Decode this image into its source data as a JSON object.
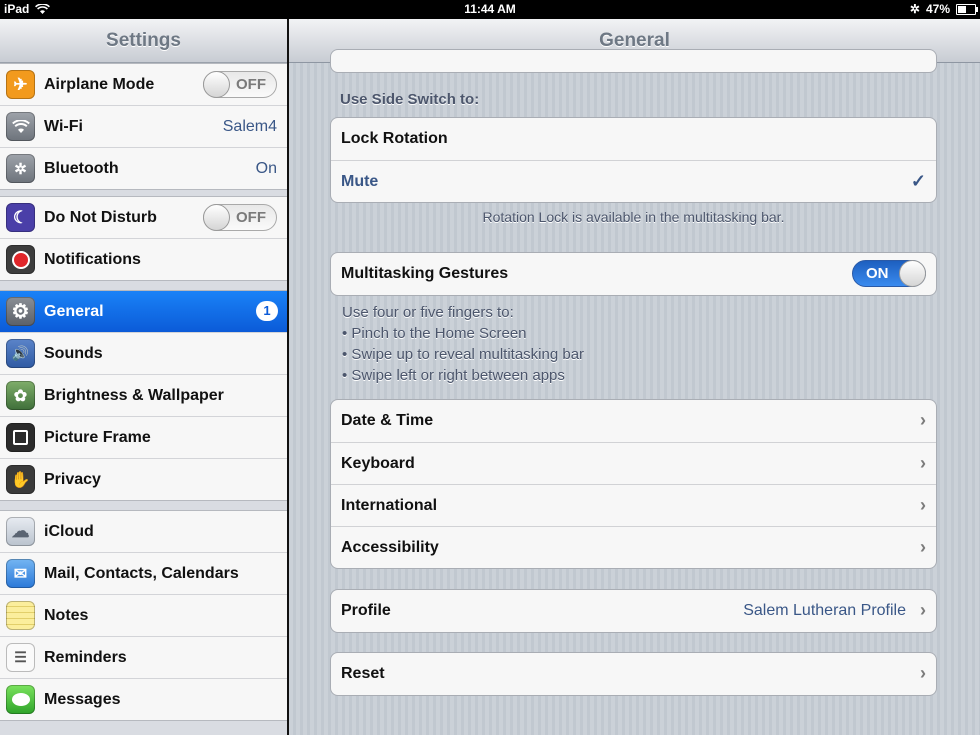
{
  "status_bar": {
    "device": "iPad",
    "time": "11:44 AM",
    "battery": "47%",
    "battery_level": 0.47
  },
  "sidebar": {
    "title": "Settings",
    "groups": [
      {
        "items": [
          {
            "label": "Airplane Mode",
            "icon": "airplane-icon",
            "toggle": "OFF"
          },
          {
            "label": "Wi-Fi",
            "icon": "wifi-icon",
            "value": "Salem4"
          },
          {
            "label": "Bluetooth",
            "icon": "bluetooth-icon",
            "value": "On"
          }
        ]
      },
      {
        "items": [
          {
            "label": "Do Not Disturb",
            "icon": "moon-icon",
            "toggle": "OFF"
          },
          {
            "label": "Notifications",
            "icon": "notifications-icon"
          }
        ]
      },
      {
        "items": [
          {
            "label": "General",
            "icon": "gear-icon",
            "badge": "1",
            "selected": true
          },
          {
            "label": "Sounds",
            "icon": "speaker-icon"
          },
          {
            "label": "Brightness & Wallpaper",
            "icon": "flower-icon"
          },
          {
            "label": "Picture Frame",
            "icon": "picture-frame-icon"
          },
          {
            "label": "Privacy",
            "icon": "hand-icon"
          }
        ]
      },
      {
        "items": [
          {
            "label": "iCloud",
            "icon": "cloud-icon"
          },
          {
            "label": "Mail, Contacts, Calendars",
            "icon": "mail-icon"
          },
          {
            "label": "Notes",
            "icon": "notes-icon"
          },
          {
            "label": "Reminders",
            "icon": "reminders-icon"
          },
          {
            "label": "Messages",
            "icon": "messages-icon"
          }
        ]
      }
    ]
  },
  "main": {
    "title": "General",
    "side_switch": {
      "header": "Use Side Switch to:",
      "lock_rotation": "Lock Rotation",
      "mute": "Mute",
      "footnote": "Rotation Lock is available in the multitasking bar."
    },
    "multitasking": {
      "label": "Multitasking Gestures",
      "toggle": "ON",
      "notes": [
        "Use four or five fingers to:",
        "• Pinch to the Home Screen",
        "• Swipe up to reveal multitasking bar",
        "• Swipe left or right between apps"
      ]
    },
    "list": {
      "date_time": "Date & Time",
      "keyboard": "Keyboard",
      "international": "International",
      "accessibility": "Accessibility"
    },
    "profile": {
      "label": "Profile",
      "value": "Salem Lutheran Profile"
    },
    "reset": {
      "label": "Reset"
    }
  }
}
